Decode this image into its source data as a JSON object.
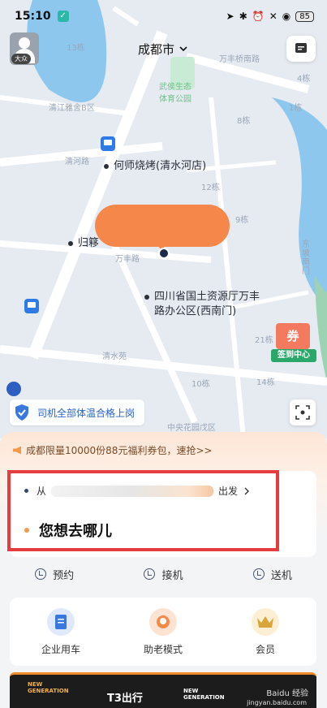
{
  "status_bar": {
    "time": "15:10",
    "battery": "85"
  },
  "header": {
    "city": "成都市",
    "avatar_badge": "大众"
  },
  "map": {
    "labels": {
      "poi_bbq": "何师烧烤(清水河店)",
      "poi_guiyi": "归簃",
      "poi_office_line1": "四川省国土资源厅万丰",
      "poi_office_line2": "路办公区(西南门)",
      "park": "武侯生态\n体育公园",
      "road_wanfeng": "万丰桥南路",
      "road_qingjiang": "清江雅舍B区",
      "road_qinghe": "清河路",
      "road_wanfeng2": "万丰路",
      "road_dongpo": "东坡南门",
      "area_qingshui": "清水苑",
      "area_garden": "中央花园戊区",
      "bldg_12": "12栋",
      "bldg_13": "13栋",
      "bldg_4": "4栋",
      "bldg_8": "8栋",
      "bldg_21": "21栋",
      "bldg_10": "10栋",
      "bldg_14": "14栋",
      "bldg_9": "9栋",
      "bldg_1": "1栋"
    },
    "coupon_center": {
      "badge": "券",
      "label": "签到中心"
    },
    "temperature_banner": "司机全部体温合格上岗"
  },
  "panel": {
    "promo_text": "成都限量10000份88元福利券包，速抢>>",
    "from_prefix": "从",
    "from_suffix": "出发",
    "destination_placeholder": "您想去哪儿",
    "services": [
      {
        "label": "预约",
        "icon": "clock-icon"
      },
      {
        "label": "接机",
        "icon": "pickup-plane-icon"
      },
      {
        "label": "送机",
        "icon": "dropoff-plane-icon"
      }
    ],
    "features": [
      {
        "label": "企业用车",
        "icon": "enterprise-doc-icon"
      },
      {
        "label": "助老模式",
        "icon": "elderly-mode-icon"
      },
      {
        "label": "会员",
        "icon": "crown-icon"
      }
    ],
    "ad": {
      "left_text": "NEW\nGENERATION",
      "brand": "T3出行",
      "right_text": "NEW\nGENERATION",
      "watermark": "Baidu 经验",
      "watermark_url": "jingyan.baidu.com"
    }
  },
  "colors": {
    "accent_orange": "#f5874a",
    "highlight_red": "#e53d3f",
    "blue": "#2a62c9"
  }
}
